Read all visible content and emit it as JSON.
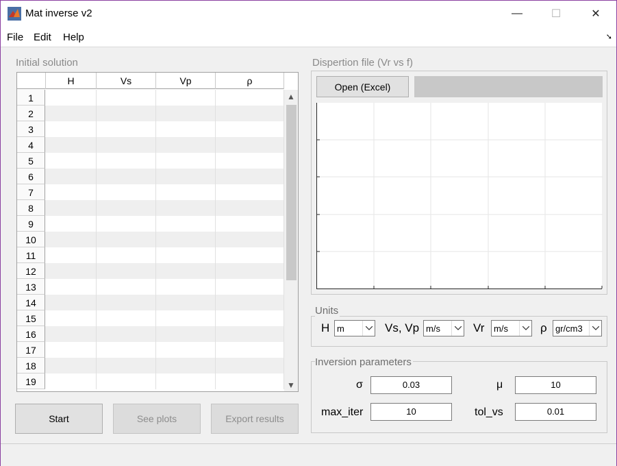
{
  "window": {
    "title": "Mat inverse v2",
    "minimize": "—",
    "maximize": "☐",
    "close": "✕"
  },
  "menu": {
    "file": "File",
    "edit": "Edit",
    "help": "Help"
  },
  "initial_solution": {
    "title": "Initial solution",
    "columns": [
      "H",
      "Vs",
      "Vp",
      "ρ"
    ],
    "row_numbers": [
      "1",
      "2",
      "3",
      "4",
      "5",
      "6",
      "7",
      "8",
      "9",
      "10",
      "11",
      "12",
      "13",
      "14",
      "15",
      "16",
      "17",
      "18",
      "19"
    ]
  },
  "buttons": {
    "start": "Start",
    "see_plots": "See plots",
    "export": "Export results"
  },
  "dispersion": {
    "title": "Dispertion file (Vr vs f)",
    "open": "Open (Excel)"
  },
  "units": {
    "title": "Units",
    "h_label": "H",
    "h_value": "m",
    "vsvp_label": "Vs, Vp",
    "vsvp_value": "m/s",
    "vr_label": "Vr",
    "vr_value": "m/s",
    "rho_label": "ρ",
    "rho_value": "gr/cm3"
  },
  "inversion": {
    "title": "Inversion parameters",
    "sigma_label": "σ",
    "sigma_value": "0.03",
    "mu_label": "μ",
    "mu_value": "10",
    "max_iter_label": "max_iter",
    "max_iter_value": "10",
    "tol_vs_label": "tol_vs",
    "tol_vs_value": "0.01"
  },
  "colors": {
    "window_border": "#8a3fa0",
    "panel_title": "#8a8a8a",
    "disabled_text": "#8d8d8d"
  }
}
